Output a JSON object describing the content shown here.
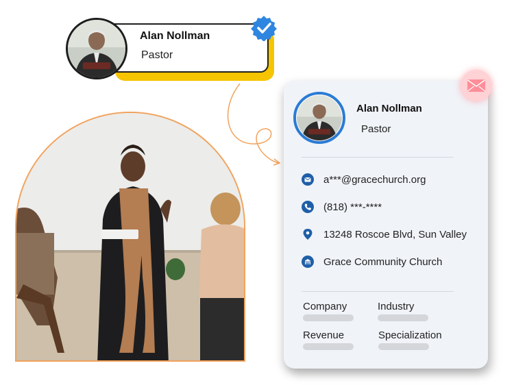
{
  "profile": {
    "name": "Alan Nollman",
    "title": "Pastor"
  },
  "contact": {
    "email": "a***@gracechurch.org",
    "phone": "(818) ***-****",
    "address": "13248 Roscoe Blvd, Sun Valley",
    "organization": "Grace Community Church"
  },
  "fields": {
    "company_label": "Company",
    "industry_label": "Industry",
    "revenue_label": "Revenue",
    "specialization_label": "Specialization"
  },
  "colors": {
    "accent_yellow": "#f6c400",
    "verified_blue": "#2f86e0",
    "icon_blue": "#1f5fa8",
    "arch_border": "#f2a25c",
    "mail_pink": "#ff8d99"
  },
  "icons": {
    "verified": "verified-check-icon",
    "mail": "envelope-icon",
    "email": "email-icon",
    "phone": "phone-icon",
    "location": "location-pin-icon",
    "building": "building-icon"
  }
}
